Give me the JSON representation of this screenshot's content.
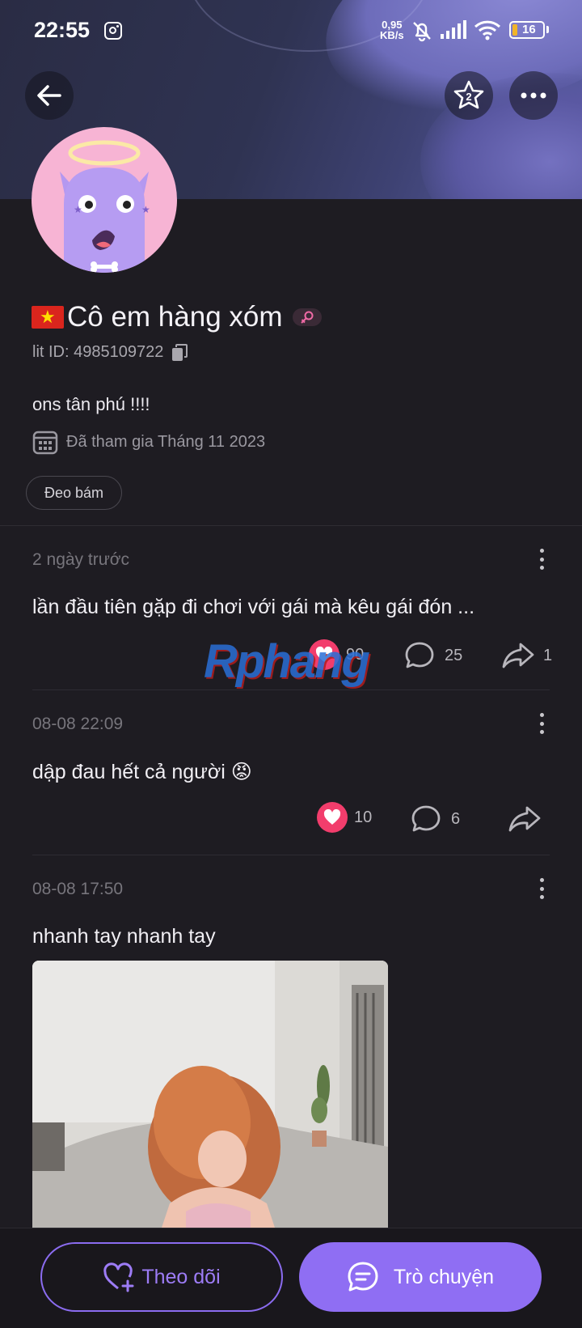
{
  "status_bar": {
    "time": "22:55",
    "net_speed_value": "0,95",
    "net_speed_unit": "KB/s",
    "battery": "16",
    "icons": [
      "instagram-icon",
      "bell-off-icon",
      "signal-icon",
      "wifi-icon",
      "battery-icon"
    ]
  },
  "header": {
    "back_icon": "arrow-left-icon",
    "star_icon": "star-badge-icon",
    "star_number": "2",
    "more_icon": "more-horizontal-icon"
  },
  "profile": {
    "flag": "★",
    "name": "Cô em hàng xóm",
    "gender_icon": "female-icon",
    "lit_id": "lit ID: 4985109722",
    "bio": "ons tân phú !!!!",
    "joined": "Đã tham gia Tháng 11 2023",
    "tag": "Đeo bám"
  },
  "posts": [
    {
      "time": "2 ngày trước",
      "text": "lần đầu tiên gặp đi chơi với gái mà kêu gái đón  ...",
      "likes": "90",
      "comments": "25",
      "shares": "1"
    },
    {
      "time": "08-08 22:09",
      "text": "dập đau hết cả người 😡",
      "likes": "10",
      "comments": "6",
      "shares": ""
    },
    {
      "time": "08-08 17:50",
      "text": "nhanh tay nhanh tay"
    }
  ],
  "watermark": "Rphang",
  "bottom": {
    "follow_label": "Theo dõi",
    "chat_label": "Trò chuyện"
  },
  "colors": {
    "accent": "#8f6ef3",
    "like": "#f23d6c",
    "background": "#1e1c22"
  }
}
